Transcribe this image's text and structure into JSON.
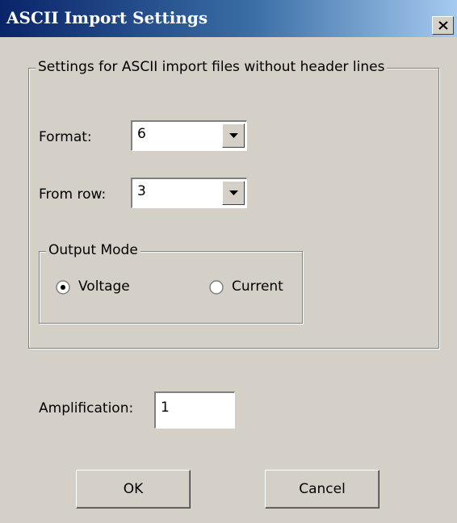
{
  "window": {
    "title": "ASCII Import Settings",
    "close_label": "×",
    "titlebar_color_start": "#0a246a",
    "titlebar_color_end": "#a6caf0",
    "background": "#d4d0c8"
  },
  "settings_group": {
    "legend": "Settings for ASCII import files without header lines",
    "format": {
      "label": "Format:",
      "value": "6"
    },
    "from_row": {
      "label": "From row:",
      "value": "3"
    },
    "output_mode": {
      "legend": "Output Mode",
      "options": [
        {
          "label": "Voltage",
          "selected": true
        },
        {
          "label": "Current",
          "selected": false
        }
      ]
    }
  },
  "amplification": {
    "label": "Amplification:",
    "value": "1"
  },
  "buttons": {
    "ok": "OK",
    "cancel": "Cancel"
  },
  "icons": {
    "close": "close-icon",
    "dropdown": "chevron-down-icon",
    "radio": "radio-icon"
  }
}
